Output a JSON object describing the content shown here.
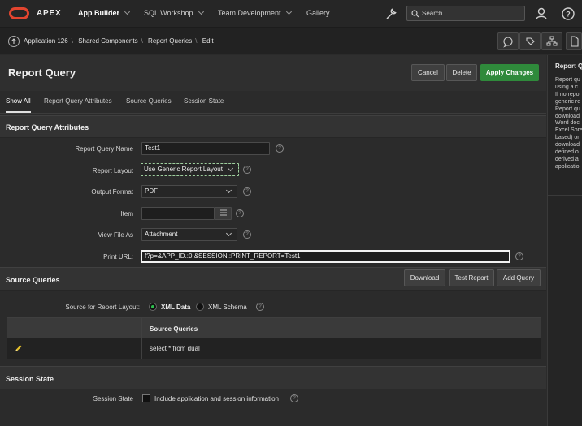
{
  "header": {
    "brand": "APEX",
    "nav": [
      "App Builder",
      "SQL Workshop",
      "Team Development",
      "Gallery"
    ],
    "search_placeholder": "Search"
  },
  "breadcrumb": [
    "Application 126",
    "Shared Components",
    "Report Queries",
    "Edit"
  ],
  "page": {
    "title": "Report Query",
    "buttons": {
      "cancel": "Cancel",
      "delete": "Delete",
      "apply": "Apply Changes"
    },
    "tabs": [
      "Show All",
      "Report Query Attributes",
      "Source Queries",
      "Session State"
    ]
  },
  "attributes": {
    "heading": "Report Query Attributes",
    "name_label": "Report Query Name",
    "name_value": "Test1",
    "layout_label": "Report Layout",
    "layout_value": "Use Generic Report Layout",
    "format_label": "Output Format",
    "format_value": "PDF",
    "item_label": "Item",
    "item_value": "",
    "viewas_label": "View File As",
    "viewas_value": "Attachment",
    "url_label": "Print URL:",
    "url_value": "f?p=&APP_ID.:0:&SESSION.:PRINT_REPORT=Test1"
  },
  "source_queries": {
    "heading": "Source Queries",
    "buttons": {
      "download": "Download",
      "test": "Test Report",
      "add": "Add Query"
    },
    "source_label": "Source for Report Layout:",
    "option_xml_data": "XML Data",
    "option_xml_schema": "XML Schema",
    "column_header": "Source Queries",
    "rows": [
      "select * from dual"
    ]
  },
  "session_state": {
    "heading": "Session State",
    "label": "Session State",
    "checkbox_label": "Include application and session information"
  },
  "help_panel": {
    "title": "Report Q",
    "body": "Report qu\nusing a c\nIf no repo\ngeneric re\nReport qu\ndownload\nWord doc\nExcel Spre\nbased) or\ndownload\ndefined o\nderived a\napplicatio"
  },
  "colors": {
    "accent": "#2f8a3b",
    "logo": "#e2452f"
  }
}
